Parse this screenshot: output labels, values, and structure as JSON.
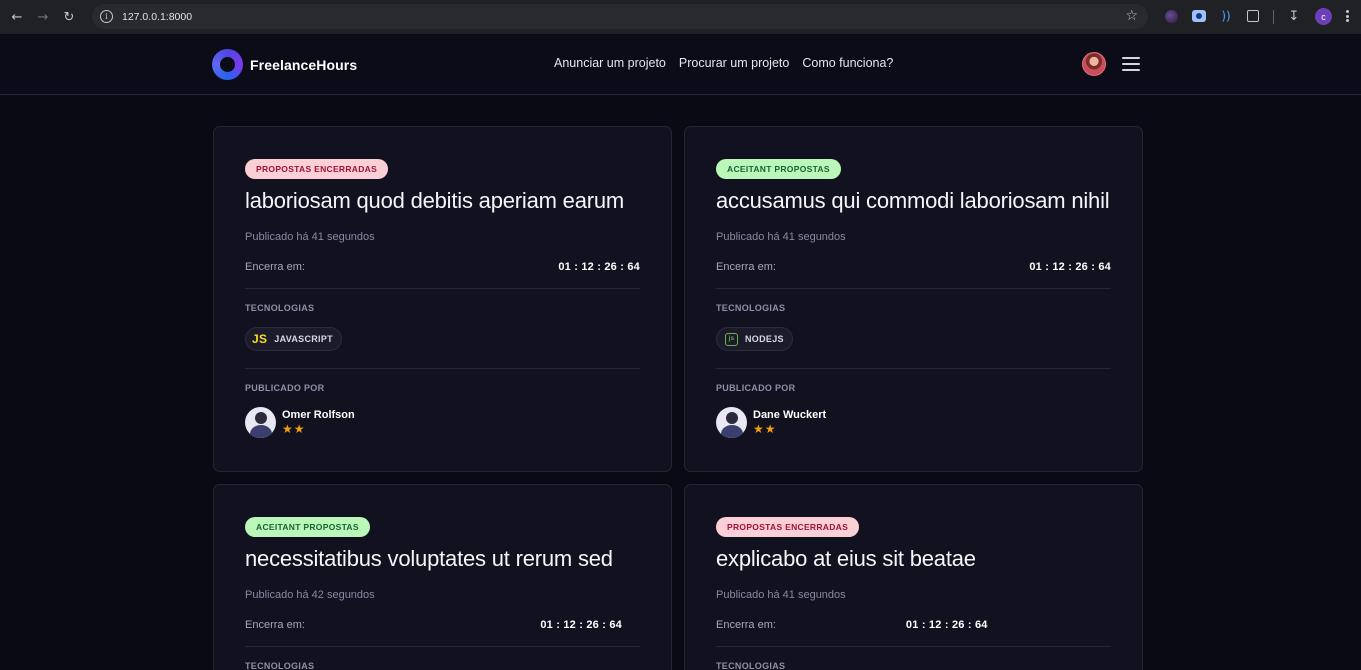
{
  "browser": {
    "url": "127.0.0.1:8000",
    "profile_initial": "c"
  },
  "site": {
    "brand": "FreelanceHours",
    "nav": [
      "Anunciar um projeto",
      "Procurar um projeto",
      "Como funciona?"
    ]
  },
  "labels": {
    "ends_in": "Encerra em:",
    "technologies": "TECNOLOGIAS",
    "published_by": "PUBLICADO POR"
  },
  "cards": [
    {
      "status": "PROPOSTAS ENCERRADAS",
      "status_type": "closed",
      "title": "laboriosam quod debitis aperiam earum",
      "published": "Publicado há 41 segundos",
      "timer": "01 : 12 : 26 : 64",
      "tech": {
        "name": "JAVASCRIPT",
        "icon": "javascript-icon"
      },
      "author": {
        "name": "Omer Rolfson",
        "rating": 2,
        "stars": "★★"
      }
    },
    {
      "status": "ACEITANT PROPOSTAS",
      "status_type": "open",
      "title": "accusamus qui commodi laboriosam nihil",
      "published": "Publicado há 41 segundos",
      "timer": "01 : 12 : 26 : 64",
      "tech": {
        "name": "NODEJS",
        "icon": "nodejs-icon"
      },
      "author": {
        "name": "Dane Wuckert",
        "rating": 2,
        "stars": "★★"
      }
    },
    {
      "status": "ACEITANT PROPOSTAS",
      "status_type": "open",
      "title": "necessitatibus voluptates ut rerum sed",
      "published": "Publicado há 42 segundos",
      "timer": "01 : 12 : 26 : 64"
    },
    {
      "status": "PROPOSTAS ENCERRADAS",
      "status_type": "closed",
      "title": "explicabo at eius sit beatae",
      "published": "Publicado há 41 segundos",
      "timer": "01 : 12 : 26 : 64"
    }
  ],
  "colors": {
    "background": "#0a0a14",
    "card": "#11111f",
    "closed_badge": "#fbcfd6",
    "open_badge": "#bbf7b9",
    "star": "#f59e0b"
  }
}
